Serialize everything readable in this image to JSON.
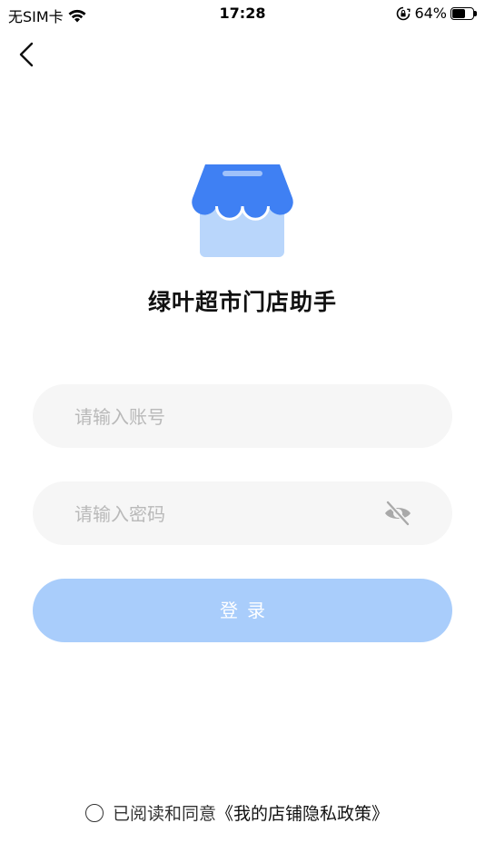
{
  "status_bar": {
    "carrier": "无SIM卡",
    "time": "17:28",
    "battery_percent_text": "64%",
    "battery_level": 0.64,
    "icons": [
      "wifi-icon",
      "orientation-lock-icon",
      "battery-icon"
    ]
  },
  "nav": {
    "back_icon": "chevron-left-icon"
  },
  "app": {
    "logo_icon": "store-awning-icon",
    "title": "绿叶超市门店助手"
  },
  "form": {
    "account_placeholder": "请输入账号",
    "account_value": "",
    "password_placeholder": "请输入密码",
    "password_value": "",
    "password_toggle_icon": "eye-off-icon",
    "login_label": "登录"
  },
  "agreement": {
    "checked": false,
    "text": "已阅读和同意",
    "policy_link": "《我的店铺隐私政策》"
  },
  "colors": {
    "primary_blue": "#3f80f3",
    "logo_light_blue": "#b9d6fb",
    "login_button": "#a9cdfb",
    "input_background": "#f6f6f6",
    "placeholder": "#b9b9b9"
  }
}
